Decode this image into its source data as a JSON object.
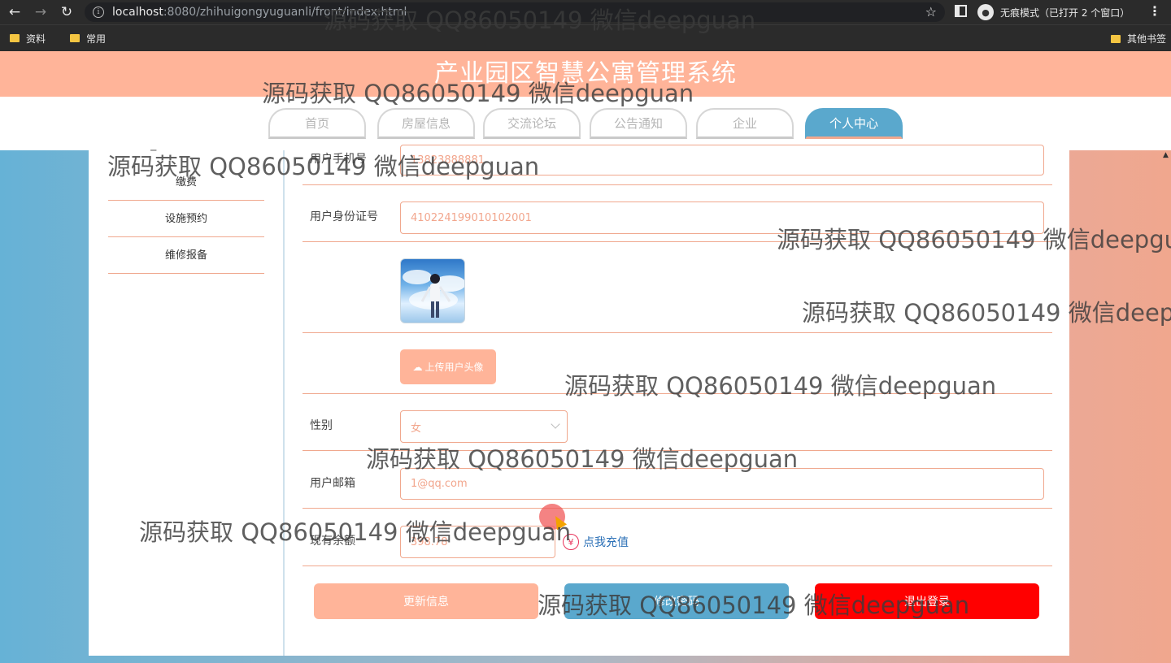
{
  "browser": {
    "url_host": "localhost",
    "url_rest": ":8080/zhihuigongyuguanli/front/index.html",
    "incognito_label": "无痕模式（已打开 2 个窗口）",
    "bookmarks": [
      "资料",
      "常用"
    ],
    "other_bookmarks": "其他书签"
  },
  "site": {
    "title": "产业园区智慧公寓管理系统",
    "nav": [
      "首页",
      "房屋信息",
      "交流论坛",
      "公告通知",
      "企业",
      "个人中心"
    ],
    "active_nav": "个人中心"
  },
  "sidebar": {
    "items": [
      "缴费",
      "设施预约",
      "维修报备"
    ]
  },
  "form": {
    "phone_label": "用户手机号",
    "phone_value": "13823888881",
    "id_label": "用户身份证号",
    "id_value": "410224199010102001",
    "upload_label": "上传用户头像",
    "gender_label": "性别",
    "gender_value": "女",
    "email_label": "用户邮箱",
    "email_value": "1@qq.com",
    "balance_label": "现有余额",
    "balance_value": "398.78",
    "recharge_label": "点我充值"
  },
  "buttons": {
    "update": "更新信息",
    "change_password": "修改密码",
    "logout": "退出登录"
  },
  "watermark": "源码获取 QQ86050149 微信deepguan",
  "colors": {
    "header": "#ffb499",
    "active_tab": "#5aa8cd",
    "logout": "#ff0000"
  }
}
